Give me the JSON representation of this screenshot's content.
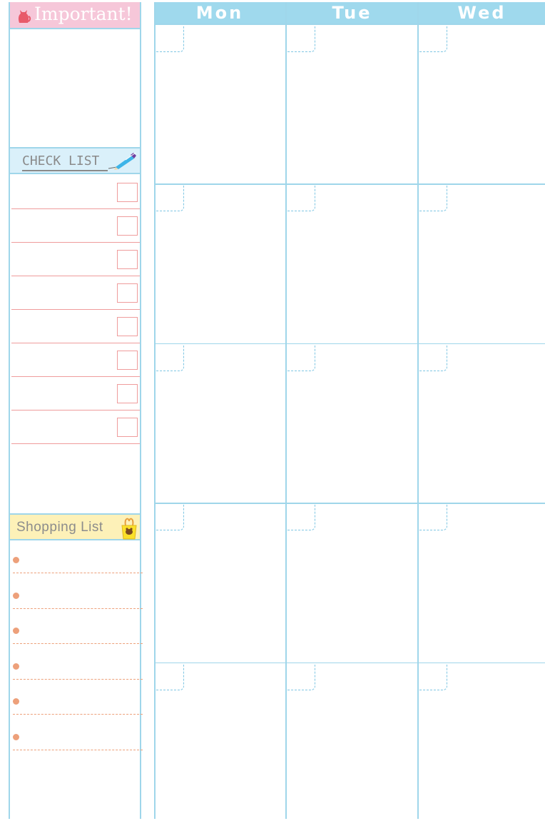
{
  "important": {
    "title": "Important!",
    "icon": "cat-icon"
  },
  "checklist": {
    "title": "CHECK LIST",
    "icon": "pen-icon",
    "item_count": 8
  },
  "shopping": {
    "title": "Shopping List",
    "icon": "shopping-bag-icon",
    "item_count": 6
  },
  "calendar": {
    "days": [
      "Mon",
      "Tue",
      "Wed"
    ],
    "weeks": 5
  },
  "colors": {
    "frame": "#9fd6ea",
    "header_blue": "#9fd9ed",
    "important_pink": "#f6c7d9",
    "checklist_blue": "#daf0fa",
    "shopping_yellow": "#fdf1b8",
    "checkbox_red": "#ef9c9c",
    "bullet_orange": "#eda07a"
  }
}
